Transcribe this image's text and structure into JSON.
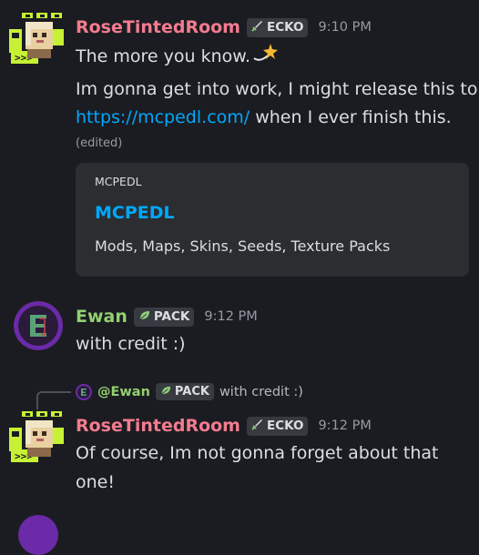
{
  "colors": {
    "rose_name": "#f47b8f",
    "ewan_name": "#93d06f",
    "link": "#00a8fc",
    "background": "#1b1c21",
    "embed_bg": "#2b2d31",
    "tag_bg": "#383a41"
  },
  "messages": [
    {
      "author": "RoseTintedRoom",
      "tag_icon": "sword-icon",
      "tag": "ECKO",
      "time": "9:10 PM",
      "line1_text": "The more you know.",
      "line1_emoji": "dizzy-star-emoji",
      "line2": "Im gonna get into work, I might release this to",
      "link": "https://mcpedl.com/",
      "line3_suffix": " when I ever finish this.",
      "edited": "(edited)",
      "embed": {
        "provider": "MCPEDL",
        "title": "MCPEDL",
        "description": "Mods, Maps, Skins, Seeds, Texture Packs"
      }
    },
    {
      "author": "Ewan",
      "tag_icon": "leaf-icon",
      "tag": "PACK",
      "time": "9:12 PM",
      "text": "with credit :)"
    },
    {
      "reply": {
        "author": "@Ewan",
        "tag": "PACK",
        "text": "with credit :)"
      },
      "author": "RoseTintedRoom",
      "tag_icon": "sword-icon",
      "tag": "ECKO",
      "time": "9:12 PM",
      "line1": "Of course, Im not gonna forget about that",
      "line2": "one!"
    }
  ]
}
